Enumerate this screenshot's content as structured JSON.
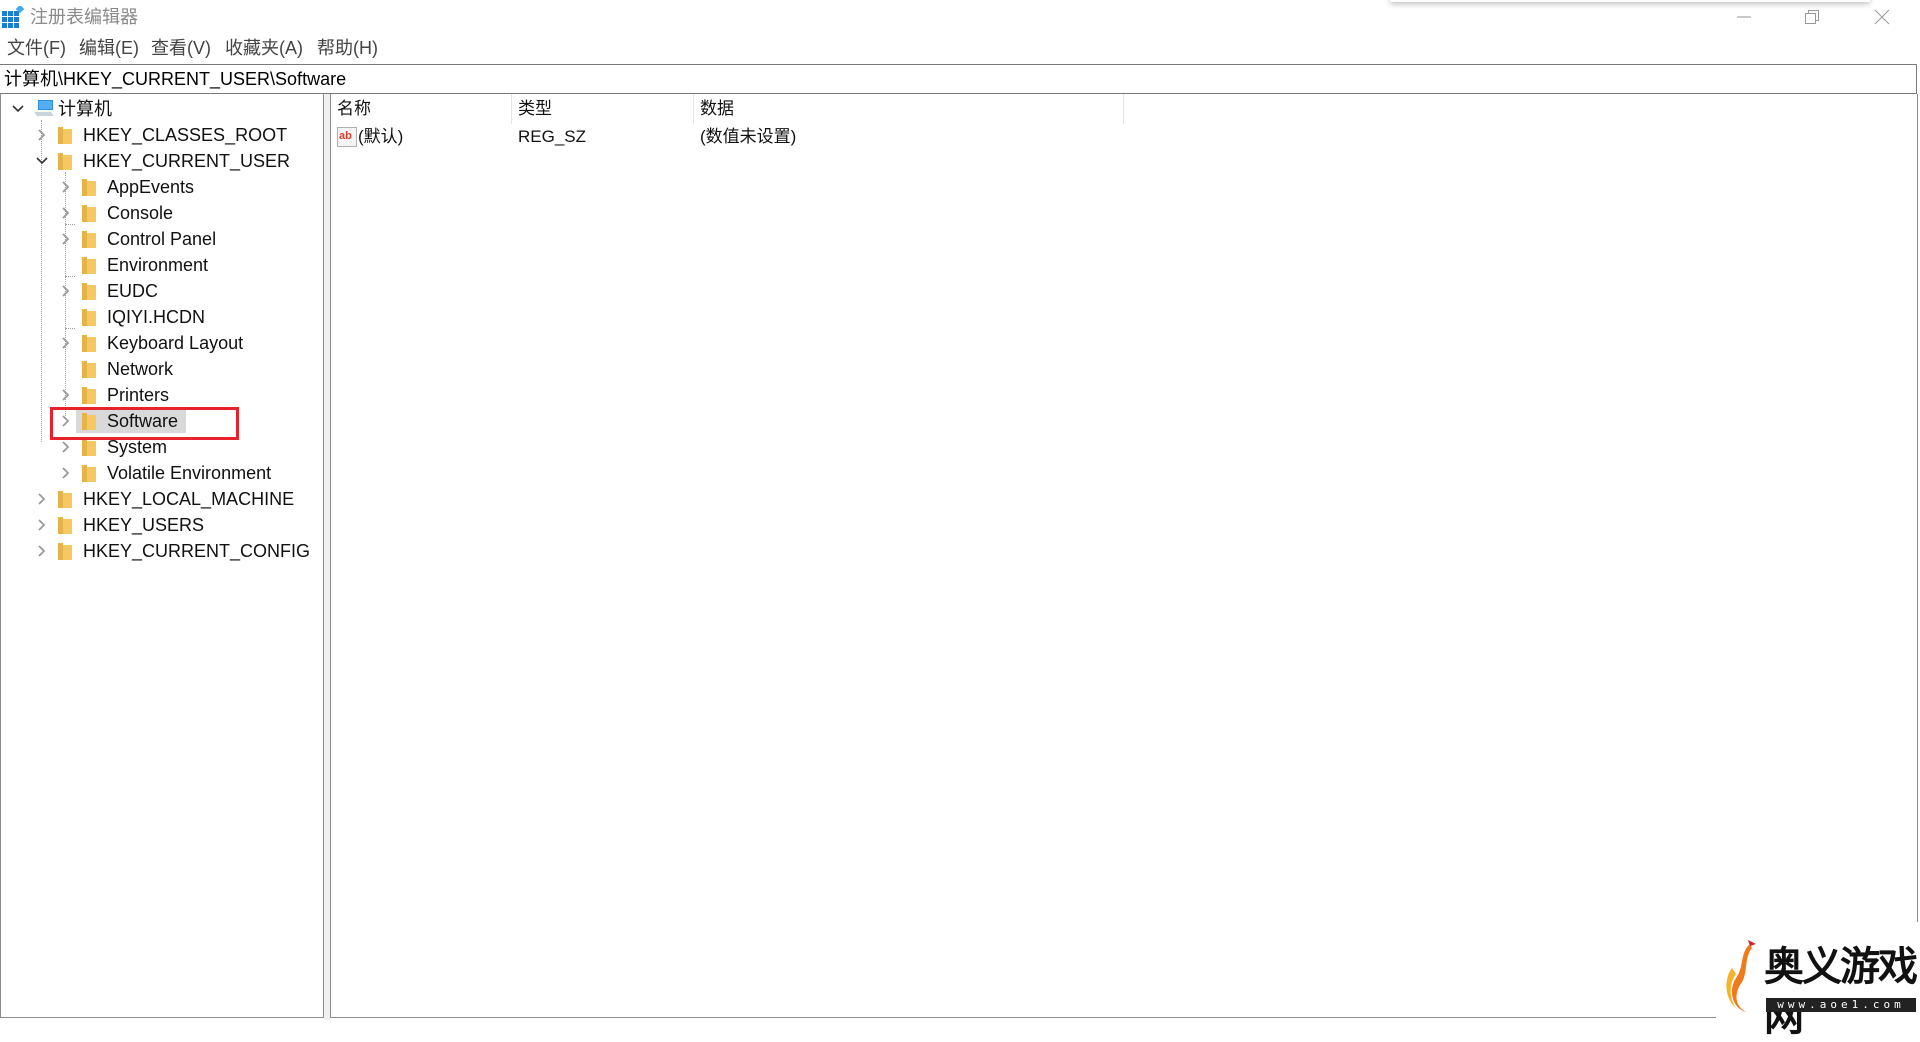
{
  "window": {
    "title": "注册表编辑器",
    "icon": "registry-editor-icon",
    "controls": {
      "minimize": "minimize-icon",
      "restore": "restore-icon",
      "close": "close-icon"
    }
  },
  "menu": [
    {
      "label": "文件(F)"
    },
    {
      "label": "编辑(E)"
    },
    {
      "label": "查看(V)"
    },
    {
      "label": "收藏夹(A)"
    },
    {
      "label": "帮助(H)"
    }
  ],
  "address": {
    "path": "计算机\\HKEY_CURRENT_USER\\Software"
  },
  "tree": {
    "root": {
      "label": "计算机",
      "icon": "computer-icon",
      "expanded": true
    },
    "hives": [
      {
        "label": "HKEY_CLASSES_ROOT",
        "expanded": false
      },
      {
        "label": "HKEY_CURRENT_USER",
        "expanded": true,
        "children": [
          {
            "label": "AppEvents",
            "has_children": true
          },
          {
            "label": "Console",
            "has_children": true
          },
          {
            "label": "Control Panel",
            "has_children": true
          },
          {
            "label": "Environment",
            "has_children": false
          },
          {
            "label": "EUDC",
            "has_children": true
          },
          {
            "label": "IQIYI.HCDN",
            "has_children": false
          },
          {
            "label": "Keyboard Layout",
            "has_children": true
          },
          {
            "label": "Network",
            "has_children": false
          },
          {
            "label": "Printers",
            "has_children": true
          },
          {
            "label": "Software",
            "has_children": true,
            "selected": true,
            "highlighted": true
          },
          {
            "label": "System",
            "has_children": true
          },
          {
            "label": "Volatile Environment",
            "has_children": true
          }
        ]
      },
      {
        "label": "HKEY_LOCAL_MACHINE",
        "expanded": false
      },
      {
        "label": "HKEY_USERS",
        "expanded": false
      },
      {
        "label": "HKEY_CURRENT_CONFIG",
        "expanded": false
      }
    ]
  },
  "list": {
    "columns": [
      "名称",
      "类型",
      "数据"
    ],
    "rows": [
      {
        "icon": "string-value-icon",
        "name": "(默认)",
        "type": "REG_SZ",
        "data": "(数值未设置)"
      }
    ]
  },
  "annotation": {
    "color": "#e8222a",
    "target": "Software"
  },
  "watermark": {
    "name": "奥义游戏网",
    "url": "www.aoe1.com"
  }
}
